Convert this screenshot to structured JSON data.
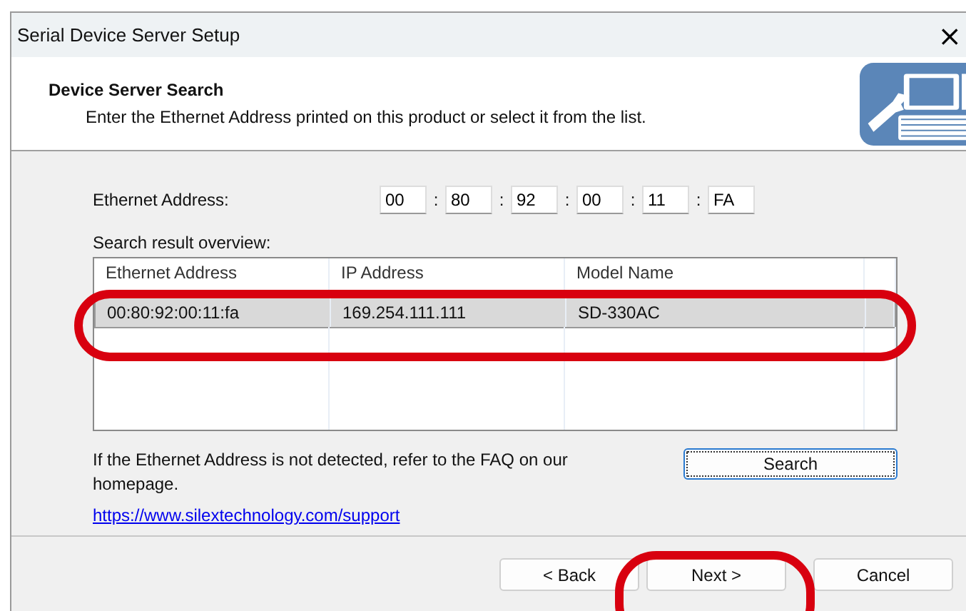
{
  "window": {
    "title": "Serial Device Server Setup",
    "close": "×"
  },
  "header": {
    "title": "Device Server Search",
    "subtitle": "Enter the Ethernet Address printed on this product or select it from the list."
  },
  "ethernet_address": {
    "label": "Ethernet Address:",
    "separator": ":",
    "octets": [
      "00",
      "80",
      "92",
      "00",
      "11",
      "FA"
    ]
  },
  "results": {
    "label": "Search result overview:",
    "columns": [
      "Ethernet Address",
      "IP Address",
      "Model Name"
    ],
    "rows": [
      {
        "cells": [
          "00:80:92:00:11:fa",
          "169.254.111.111",
          "SD-330AC"
        ],
        "selected": true
      }
    ]
  },
  "note": "If the Ethernet Address is not detected, refer to the FAQ on our homepage.",
  "link": "https://www.silextechnology.com/support",
  "search_button": {
    "label": "Search",
    "focused": true
  },
  "buttons": [
    "< Back",
    "Next >",
    "Cancel"
  ]
}
